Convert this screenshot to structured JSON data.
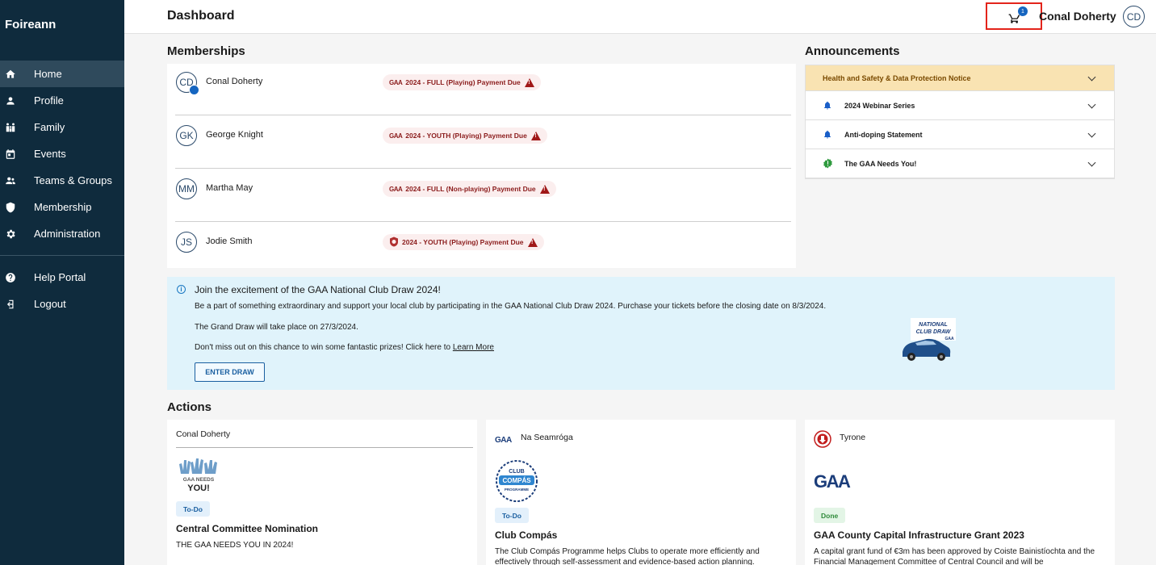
{
  "app": {
    "brand": "Foireann"
  },
  "sidebar": {
    "items": [
      {
        "label": "Home",
        "icon": "home-icon"
      },
      {
        "label": "Profile",
        "icon": "person-icon"
      },
      {
        "label": "Family",
        "icon": "family-icon"
      },
      {
        "label": "Events",
        "icon": "calendar-icon"
      },
      {
        "label": "Teams & Groups",
        "icon": "group-icon"
      },
      {
        "label": "Membership",
        "icon": "shield-icon"
      },
      {
        "label": "Administration",
        "icon": "gear-icon"
      }
    ],
    "secondary": [
      {
        "label": "Help Portal",
        "icon": "help-icon"
      },
      {
        "label": "Logout",
        "icon": "logout-icon"
      }
    ]
  },
  "header": {
    "title": "Dashboard",
    "cart_count": "1",
    "user_name": "Conal Doherty",
    "user_initials": "CD"
  },
  "memberships": {
    "title": "Memberships",
    "rows": [
      {
        "initials": "CD",
        "name": "Conal Doherty",
        "badge_logo": "GAA",
        "badge": "2024 - FULL (Playing) Payment Due"
      },
      {
        "initials": "GK",
        "name": "George Knight",
        "badge_logo": "GAA",
        "badge": "2024 - YOUTH (Playing) Payment Due"
      },
      {
        "initials": "MM",
        "name": "Martha May",
        "badge_logo": "GAA",
        "badge": "2024 - FULL (Non-playing) Payment Due"
      },
      {
        "initials": "JS",
        "name": "Jodie Smith",
        "badge_logo": "crest",
        "badge": "2024 - YOUTH (Playing) Payment Due"
      }
    ]
  },
  "announcements": {
    "title": "Announcements",
    "items": [
      {
        "title": "Health and Safety & Data Protection Notice",
        "icon": ""
      },
      {
        "title": "2024 Webinar Series",
        "icon": "bell-icon"
      },
      {
        "title": "Anti-doping Statement",
        "icon": "bell-icon"
      },
      {
        "title": "The GAA Needs You!",
        "icon": "alert-badge-icon"
      }
    ]
  },
  "banner": {
    "title": "Join the excitement of the GAA National Club Draw 2024!",
    "line1": "Be a part of something extraordinary and support your local club by participating in the GAA National Club Draw 2024. Purchase your tickets before the closing date on 8/3/2024.",
    "line2": "The Grand Draw will take place on 27/3/2024.",
    "line3": "Don't miss out on this chance to win some fantastic prizes! Click here to ",
    "link": "Learn More",
    "button": "ENTER DRAW",
    "image_text": "NATIONAL CLUB DRAW"
  },
  "actions": {
    "title": "Actions",
    "cards": [
      {
        "org": "Conal Doherty",
        "logo_text": "GAA NEEDS YOU!",
        "status": "To-Do",
        "title": "Central Committee Nomination",
        "desc": "THE GAA NEEDS YOU IN 2024!"
      },
      {
        "org": "Na Seamróga",
        "org_logo": "GAA",
        "logo_text": "CLUB COMPÁS PROGRAMME",
        "status": "To-Do",
        "title": "Club Compás",
        "desc": "The Club Compás Programme helps Clubs to operate more efficiently and effectively through self-assessment and evidence-based action planning."
      },
      {
        "org": "Tyrone",
        "logo_text": "GAA",
        "status": "Done",
        "title": "GAA County Capital Infrastructure Grant 2023",
        "desc": "A capital grant fund of €3m has been approved by Coiste Bainistíochta and the Financial Management Committee of Central Council and will be"
      }
    ]
  },
  "colors": {
    "sidebar": "#0f2b3d",
    "accent": "#1565c0",
    "alert": "#a01818",
    "highlight": "#e3241b"
  }
}
